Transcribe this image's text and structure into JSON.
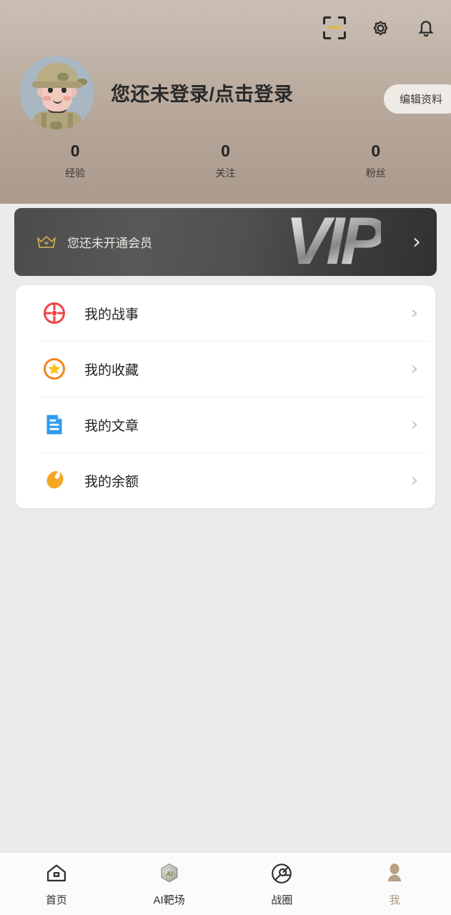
{
  "header": {
    "icons": [
      {
        "name": "scan-icon",
        "label": "扫一扫"
      },
      {
        "name": "gear-icon",
        "label": "设置"
      },
      {
        "name": "bell-icon",
        "label": "通知"
      }
    ],
    "username": "您还未登录/点击登录",
    "edit_profile_label": "编辑资料",
    "avatar_alt": "soldier-avatar",
    "bg_color": "#b5a598"
  },
  "stats": [
    {
      "value": "0",
      "label": "经验"
    },
    {
      "value": "0",
      "label": "关注"
    },
    {
      "value": "0",
      "label": "粉丝"
    }
  ],
  "vip": {
    "text": "您还未开通会员",
    "logo": "VIP",
    "arrow": "›",
    "crown_color": "#c9a84c"
  },
  "menu": [
    {
      "label": "我的战事",
      "icon": "target-icon",
      "color": "#ef4444",
      "arrow": "›"
    },
    {
      "label": "我的收藏",
      "icon": "star-icon",
      "color": "#f39524",
      "arrow": "›"
    },
    {
      "label": "我的文章",
      "icon": "document-icon",
      "color": "#2e9bf0",
      "arrow": "›"
    },
    {
      "label": "我的余额",
      "icon": "coin-bean-icon",
      "color": "#f5a623",
      "arrow": "›"
    }
  ],
  "tabbar": [
    {
      "label": "首页",
      "icon": "home-icon",
      "active": false
    },
    {
      "label": "AI靶场",
      "icon": "hexagon-ai-icon",
      "active": false
    },
    {
      "label": "战圈",
      "icon": "aperture-icon",
      "active": false
    },
    {
      "label": "我",
      "icon": "person-icon",
      "active": true
    }
  ]
}
